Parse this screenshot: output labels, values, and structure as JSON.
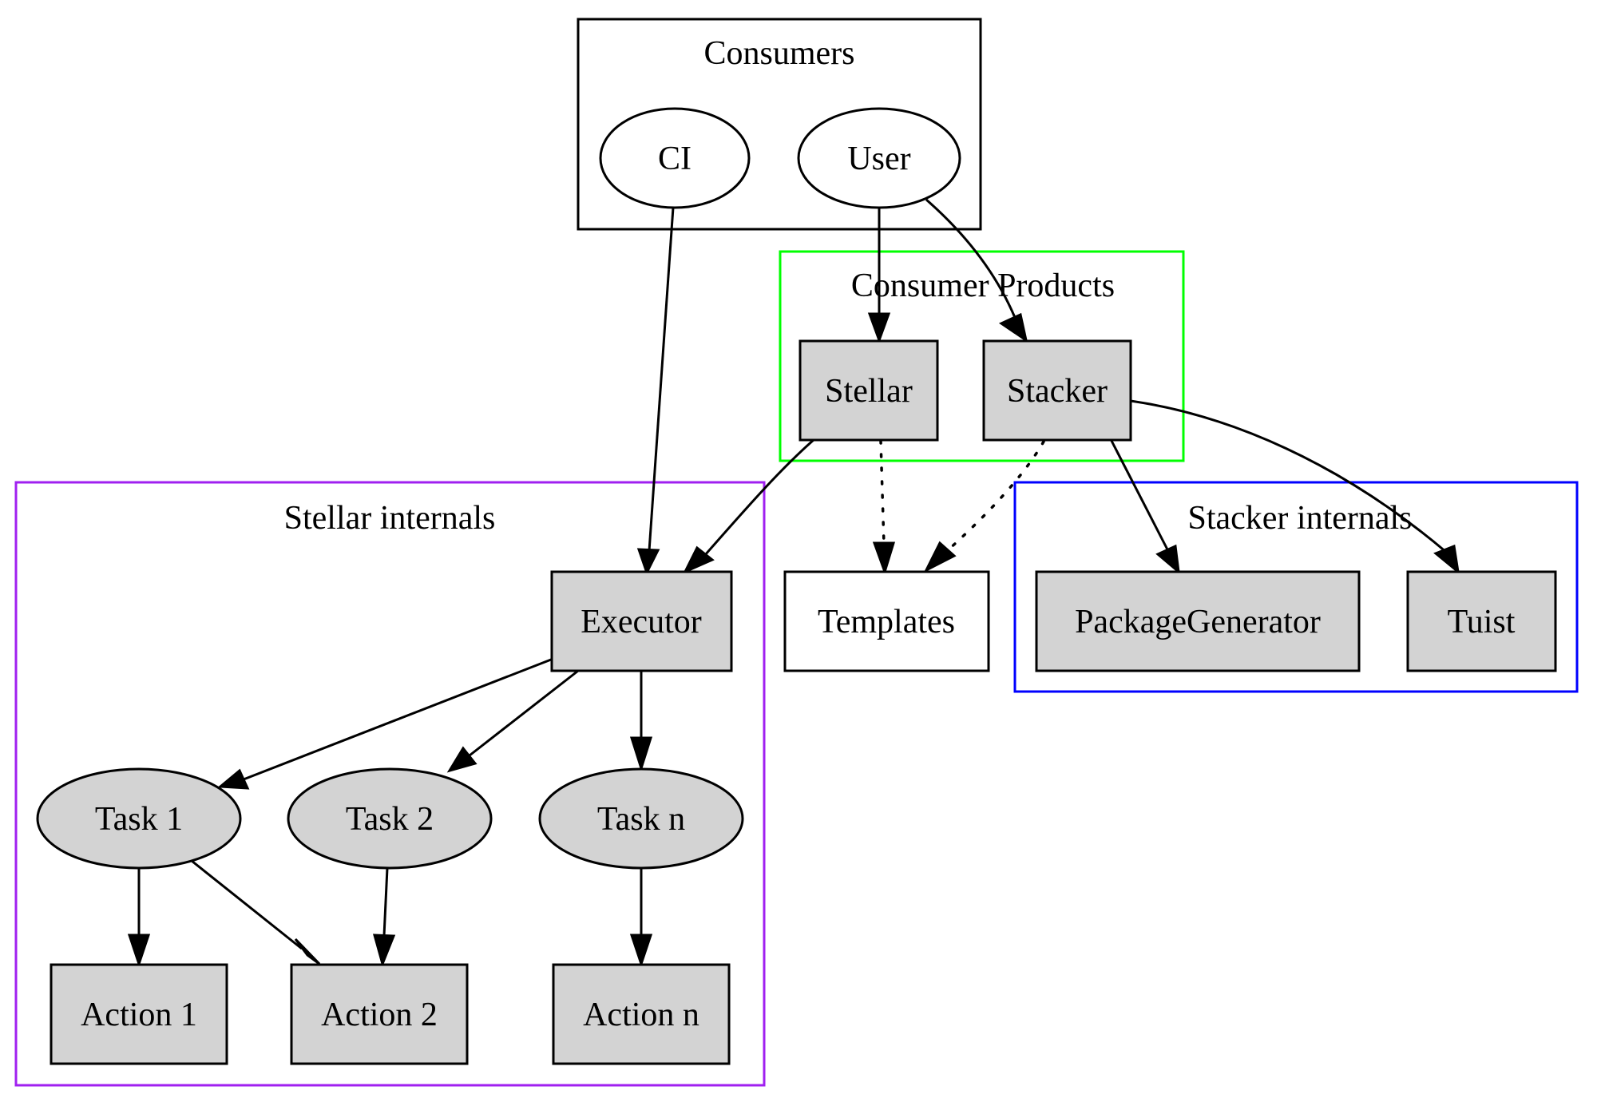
{
  "diagram": {
    "clusters": [
      {
        "id": "consumers",
        "label": "Consumers",
        "color": "#000000"
      },
      {
        "id": "consumer_products",
        "label": "Consumer Products",
        "color": "#00ff00"
      },
      {
        "id": "stellar_internals",
        "label": "Stellar internals",
        "color": "#a020f0"
      },
      {
        "id": "stacker_internals",
        "label": "Stacker internals",
        "color": "#0000ff"
      }
    ],
    "nodes": {
      "ci": {
        "label": "CI",
        "shape": "ellipse",
        "fill": "#ffffff"
      },
      "user": {
        "label": "User",
        "shape": "ellipse",
        "fill": "#ffffff"
      },
      "stellar": {
        "label": "Stellar",
        "shape": "box",
        "fill": "#d3d3d3"
      },
      "stacker": {
        "label": "Stacker",
        "shape": "box",
        "fill": "#d3d3d3"
      },
      "executor": {
        "label": "Executor",
        "shape": "box",
        "fill": "#d3d3d3"
      },
      "templates": {
        "label": "Templates",
        "shape": "box",
        "fill": "#ffffff"
      },
      "package_generator": {
        "label": "PackageGenerator",
        "shape": "box",
        "fill": "#d3d3d3"
      },
      "tuist": {
        "label": "Tuist",
        "shape": "box",
        "fill": "#d3d3d3"
      },
      "task1": {
        "label": "Task 1",
        "shape": "ellipse",
        "fill": "#d3d3d3"
      },
      "task2": {
        "label": "Task 2",
        "shape": "ellipse",
        "fill": "#d3d3d3"
      },
      "taskn": {
        "label": "Task n",
        "shape": "ellipse",
        "fill": "#d3d3d3"
      },
      "action1": {
        "label": "Action 1",
        "shape": "box",
        "fill": "#d3d3d3"
      },
      "action2": {
        "label": "Action 2",
        "shape": "box",
        "fill": "#d3d3d3"
      },
      "actionn": {
        "label": "Action n",
        "shape": "box",
        "fill": "#d3d3d3"
      }
    },
    "edges": [
      {
        "from": "CI",
        "to": "Executor",
        "style": "solid"
      },
      {
        "from": "User",
        "to": "Stellar",
        "style": "solid"
      },
      {
        "from": "User",
        "to": "Stacker",
        "style": "solid"
      },
      {
        "from": "Stellar",
        "to": "Executor",
        "style": "solid"
      },
      {
        "from": "Stellar",
        "to": "Templates",
        "style": "dotted"
      },
      {
        "from": "Stacker",
        "to": "Templates",
        "style": "dotted"
      },
      {
        "from": "Stacker",
        "to": "PackageGenerator",
        "style": "solid"
      },
      {
        "from": "Stacker",
        "to": "Tuist",
        "style": "solid"
      },
      {
        "from": "Executor",
        "to": "Task 1",
        "style": "solid"
      },
      {
        "from": "Executor",
        "to": "Task 2",
        "style": "solid"
      },
      {
        "from": "Executor",
        "to": "Task n",
        "style": "solid"
      },
      {
        "from": "Task 1",
        "to": "Action 1",
        "style": "solid"
      },
      {
        "from": "Task 1",
        "to": "Action 2",
        "style": "solid"
      },
      {
        "from": "Task 2",
        "to": "Action 2",
        "style": "solid"
      },
      {
        "from": "Task n",
        "to": "Action n",
        "style": "solid"
      }
    ]
  }
}
